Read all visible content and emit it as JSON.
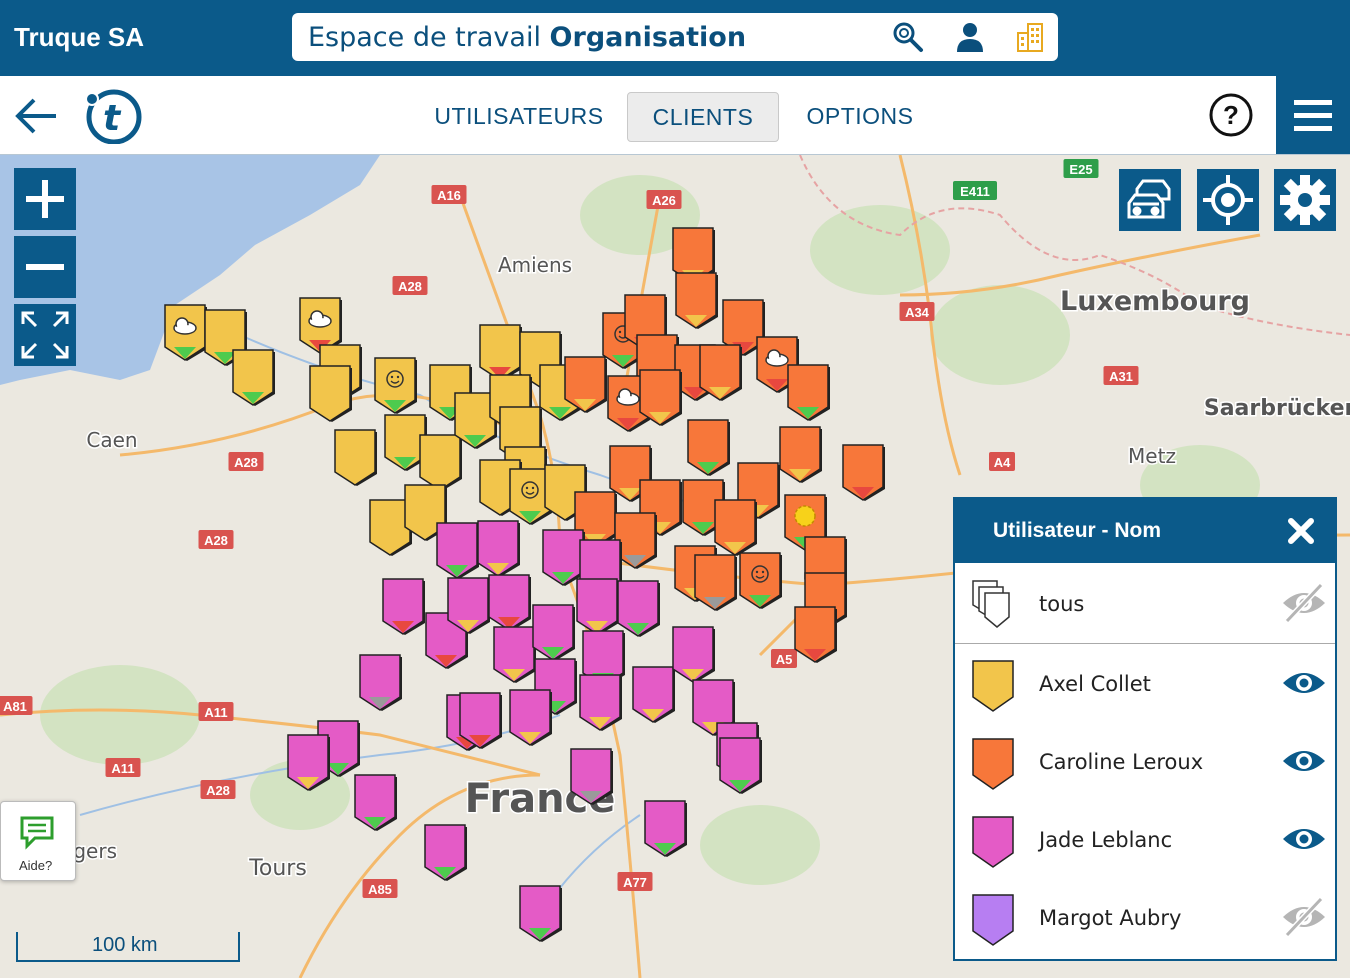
{
  "header": {
    "company": "Truque SA",
    "workspace_prefix": "Espace de travail",
    "workspace_name": "Organisation"
  },
  "nav": {
    "tabs": [
      {
        "label": "UTILISATEURS",
        "active": false
      },
      {
        "label": "CLIENTS",
        "active": true
      },
      {
        "label": "OPTIONS",
        "active": false
      }
    ]
  },
  "map": {
    "place_labels": [
      "Amiens",
      "Caen",
      "Luxembourg",
      "Saarbrücken",
      "Metz",
      "Tours",
      "Angers",
      "France"
    ],
    "road_labels": [
      "A16",
      "A26",
      "A28",
      "A34",
      "E411",
      "E25",
      "A31",
      "A4",
      "A28",
      "A28",
      "A28",
      "A5",
      "A81",
      "A11",
      "A11",
      "A85",
      "A77"
    ],
    "scale_label": "100 km"
  },
  "panel": {
    "title": "Utilisateur - Nom",
    "rows": [
      {
        "label": "tous",
        "color": "#ffffff",
        "visible": false
      },
      {
        "label": "Axel Collet",
        "color": "#f2c54b",
        "visible": true
      },
      {
        "label": "Caroline Leroux",
        "color": "#f7773a",
        "visible": true
      },
      {
        "label": "Jade Leblanc",
        "color": "#e45bc6",
        "visible": true
      },
      {
        "label": "Margot Aubry",
        "color": "#b77ef2",
        "visible": false
      }
    ]
  },
  "help_widget": {
    "label": "Aide?"
  },
  "icons": {
    "search": "search-icon",
    "user": "user-icon",
    "building": "building-icon",
    "back": "back-arrow-icon",
    "help": "question-icon",
    "menu": "hamburger-icon",
    "zoom_in": "plus-icon",
    "zoom_out": "minus-icon",
    "fullscreen": "expand-icon",
    "traffic": "traffic-cars-icon",
    "locate": "crosshair-icon",
    "settings": "gear-icon",
    "close": "close-icon",
    "visible": "eye-icon",
    "hidden": "eye-off-icon"
  }
}
